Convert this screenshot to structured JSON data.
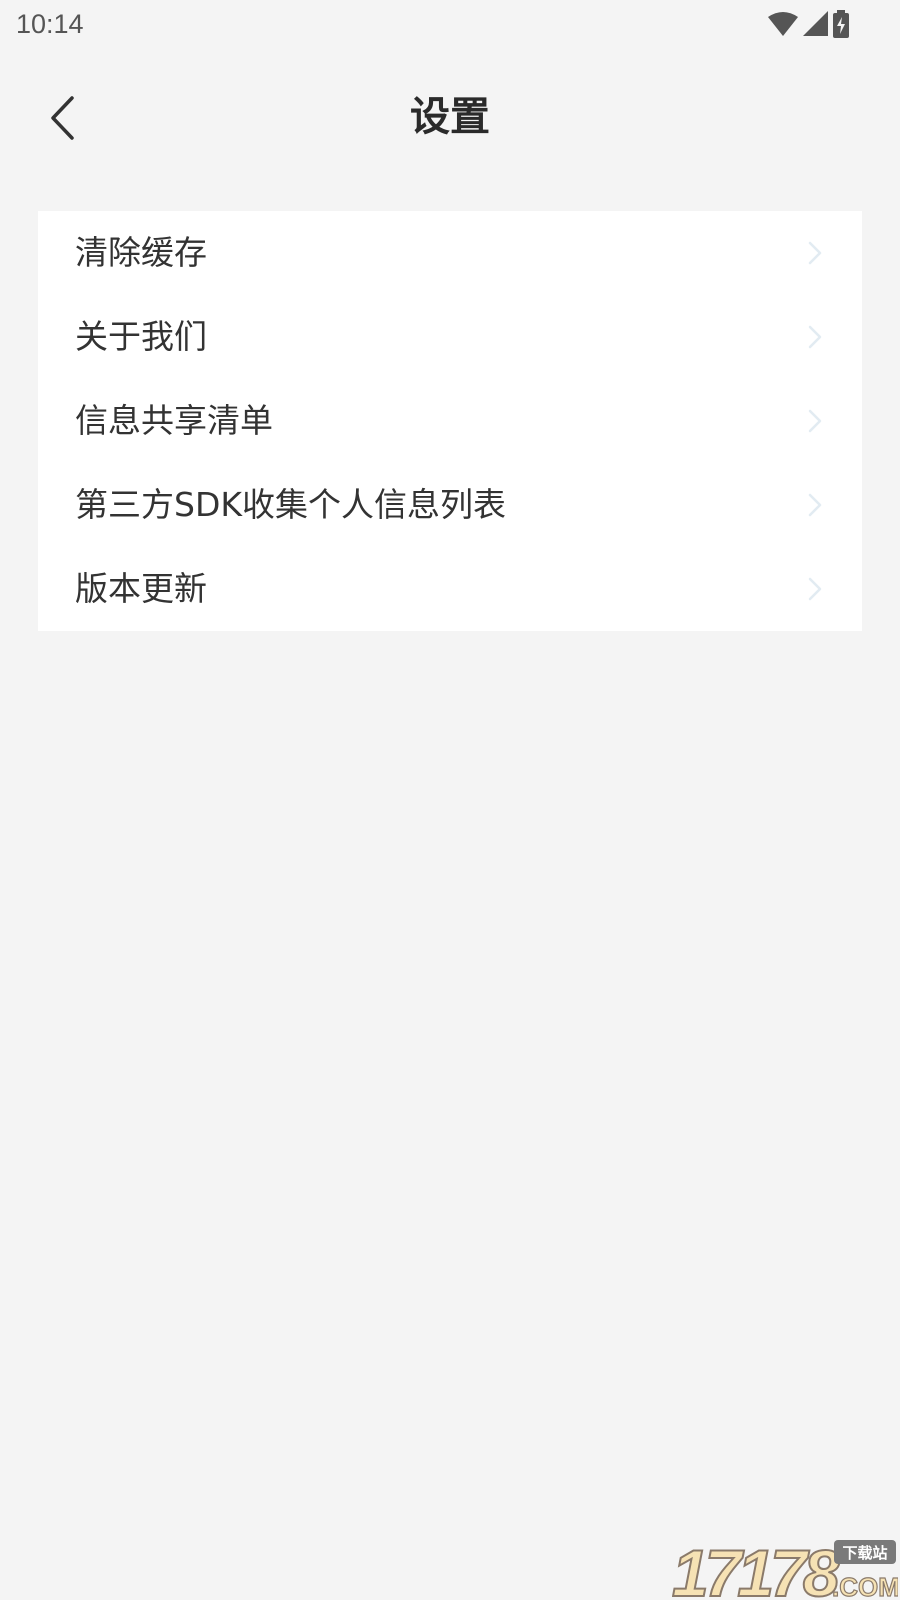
{
  "status_bar": {
    "time": "10:14",
    "icons": [
      "wifi-icon",
      "signal-icon",
      "battery-charging-icon"
    ]
  },
  "header": {
    "back_icon": "chevron-left-icon",
    "title": "设置"
  },
  "settings": {
    "items": [
      {
        "label": "清除缓存"
      },
      {
        "label": "关于我们"
      },
      {
        "label": "信息共享清单"
      },
      {
        "label": "第三方SDK收集个人信息列表"
      },
      {
        "label": "版本更新"
      }
    ]
  },
  "watermark": {
    "text": "17178",
    "badge": "下载站",
    "domain": ".COM"
  },
  "colors": {
    "background": "#f4f4f4",
    "card": "#ffffff",
    "text": "#333333",
    "chevron": "#e6eef4"
  }
}
